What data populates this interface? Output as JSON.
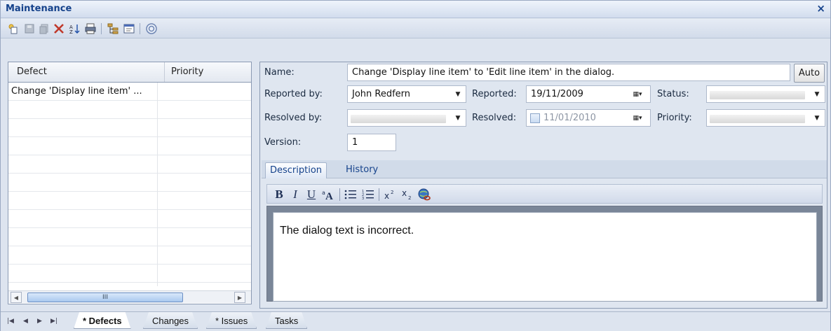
{
  "window": {
    "title": "Maintenance",
    "close_glyph": "×"
  },
  "toolbar": {
    "buttons": [
      "new-item-icon",
      "save-icon",
      "copy-icon",
      "delete-icon",
      "sort-icon",
      "print-icon",
      "hierarchy-icon",
      "properties-icon",
      "help-icon"
    ]
  },
  "grid": {
    "columns": [
      "Defect",
      "Priority"
    ],
    "rows": [
      {
        "defect": "Change 'Display line item' ...",
        "priority": ""
      }
    ],
    "scroll_thumb_glyph": "III"
  },
  "form": {
    "name_label": "Name:",
    "name_value": "Change 'Display line item' to 'Edit line item' in the dialog.",
    "auto_label": "Auto",
    "reported_by_label": "Reported by:",
    "reported_by_value": "John Redfern",
    "reported_label": "Reported:",
    "reported_value": "19/11/2009",
    "status_label": "Status:",
    "resolved_by_label": "Resolved by:",
    "resolved_label": "Resolved:",
    "resolved_value": "11/01/2010",
    "priority_label": "Priority:",
    "version_label": "Version:",
    "version_value": "1"
  },
  "detail_tabs": [
    {
      "label": "Description",
      "active": true
    },
    {
      "label": "History",
      "active": false
    }
  ],
  "format_toolbar": {
    "bold": "B",
    "italic": "I",
    "underline": "U",
    "buttons": [
      "bold-icon",
      "italic-icon",
      "underline-icon",
      "font-icon",
      "bullet-list-icon",
      "numbered-list-icon",
      "superscript-icon",
      "subscript-icon",
      "hyperlink-icon"
    ]
  },
  "description_text": "The dialog text is incorrect.",
  "sheet_tabs": [
    {
      "label": "* Defects",
      "active": true
    },
    {
      "label": "Changes",
      "active": false
    },
    {
      "label": "* Issues",
      "active": false
    },
    {
      "label": "Tasks",
      "active": false
    }
  ],
  "colors": {
    "title_text": "#15428b",
    "panel_bg": "#dde4ef",
    "accent": "#6b8fc4"
  }
}
